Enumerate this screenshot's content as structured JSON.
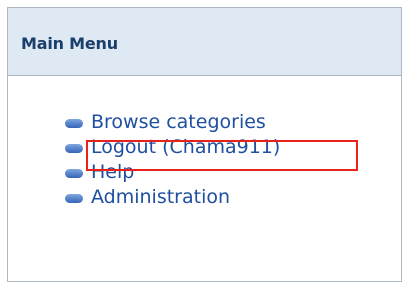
{
  "panel": {
    "title": "Main Menu"
  },
  "menu": {
    "items": [
      {
        "label": "Browse categories"
      },
      {
        "label": "Logout (Chama911)"
      },
      {
        "label": "Help"
      },
      {
        "label": "Administration"
      }
    ]
  },
  "colors": {
    "header_background": "#dfe9f3",
    "title_text": "#1a3f6b",
    "link_text": "#1e4fa0",
    "highlight_border": "#e8221b"
  }
}
